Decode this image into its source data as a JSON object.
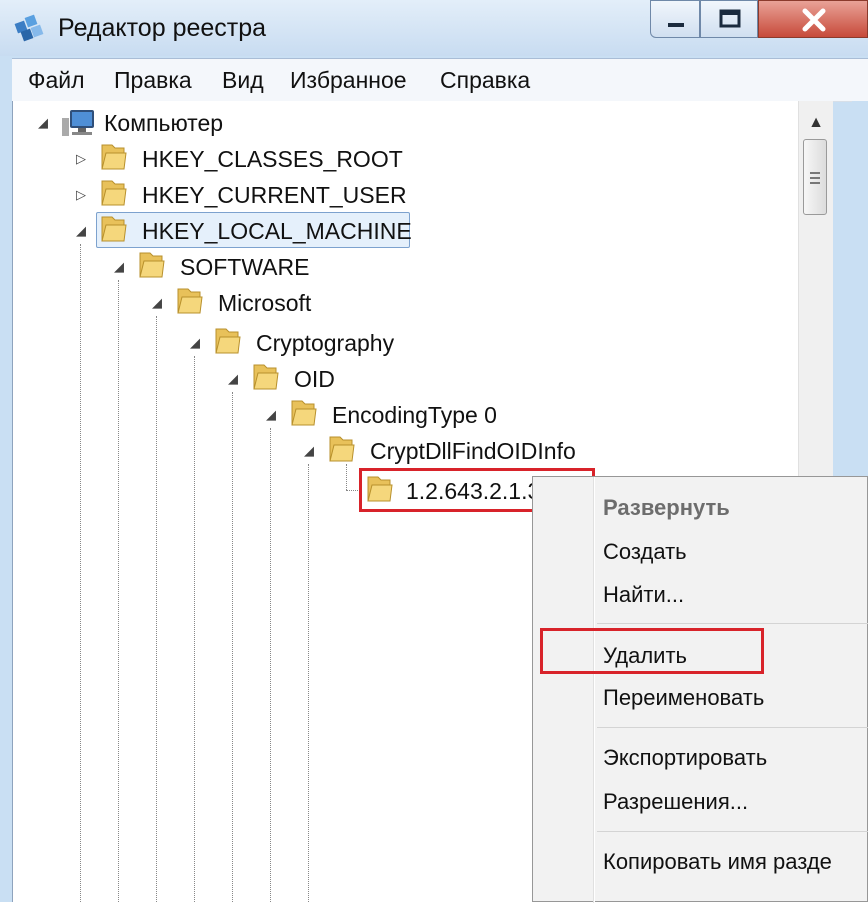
{
  "window": {
    "title": "Редактор реестра",
    "app_icon": "registry-editor-icon"
  },
  "menubar": {
    "items": [
      "Файл",
      "Правка",
      "Вид",
      "Избранное",
      "Справка"
    ]
  },
  "tree": {
    "root": "Компьютер",
    "nodes": [
      "HKEY_CLASSES_ROOT",
      "HKEY_CURRENT_USER",
      "HKEY_LOCAL_MACHINE",
      "SOFTWARE",
      "Microsoft",
      "Cryptography",
      "OID",
      "EncodingType 0",
      "CryptDllFindOIDInfo",
      "1.2.643.2.1.3"
    ]
  },
  "context_menu": {
    "items": [
      "Развернуть",
      "Создать",
      "Найти...",
      "Удалить",
      "Переименовать",
      "Экспортировать",
      "Разрешения...",
      "Копировать имя разде"
    ]
  },
  "colors": {
    "highlight": "#d8232a",
    "selection": "#e5f0fb",
    "folder": "#e8c15a"
  }
}
